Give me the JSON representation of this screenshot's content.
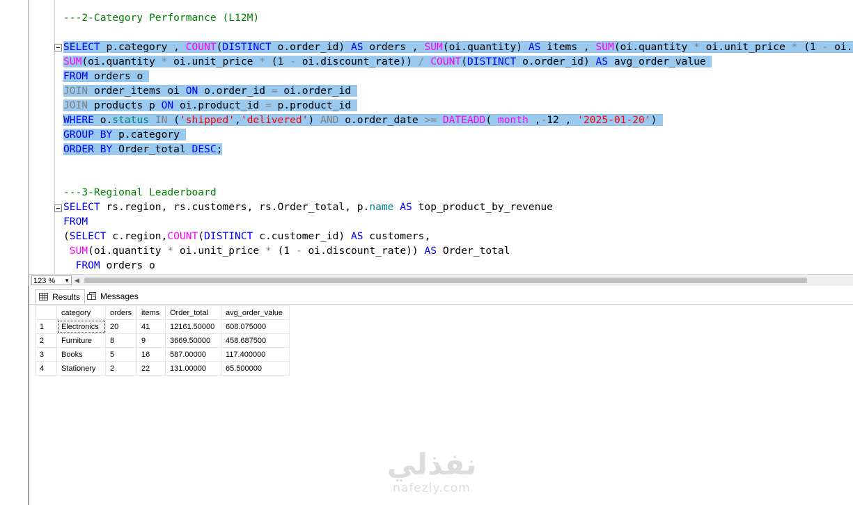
{
  "editor": {
    "lines": {
      "l0": "---2-Category Performance (L12M)",
      "l3": "---3-Regional Leaderboard"
    }
  },
  "zoom": {
    "value": "123 %"
  },
  "tabs": {
    "results": "Results",
    "messages": "Messages"
  },
  "results": {
    "columns": [
      "category",
      "orders",
      "items",
      "Order_total",
      "avg_order_value"
    ],
    "rows": [
      [
        "1",
        "Electronics",
        "20",
        "41",
        "12161.50000",
        "608.075000"
      ],
      [
        "2",
        "Furniture",
        "8",
        "9",
        "3669.50000",
        "458.687500"
      ],
      [
        "3",
        "Books",
        "5",
        "16",
        "587.00000",
        "117.400000"
      ],
      [
        "4",
        "Stationery",
        "2",
        "22",
        "131.00000",
        "65.500000"
      ]
    ]
  },
  "watermark": {
    "arabic": "نفذلي",
    "latin": "nafezly.com"
  }
}
